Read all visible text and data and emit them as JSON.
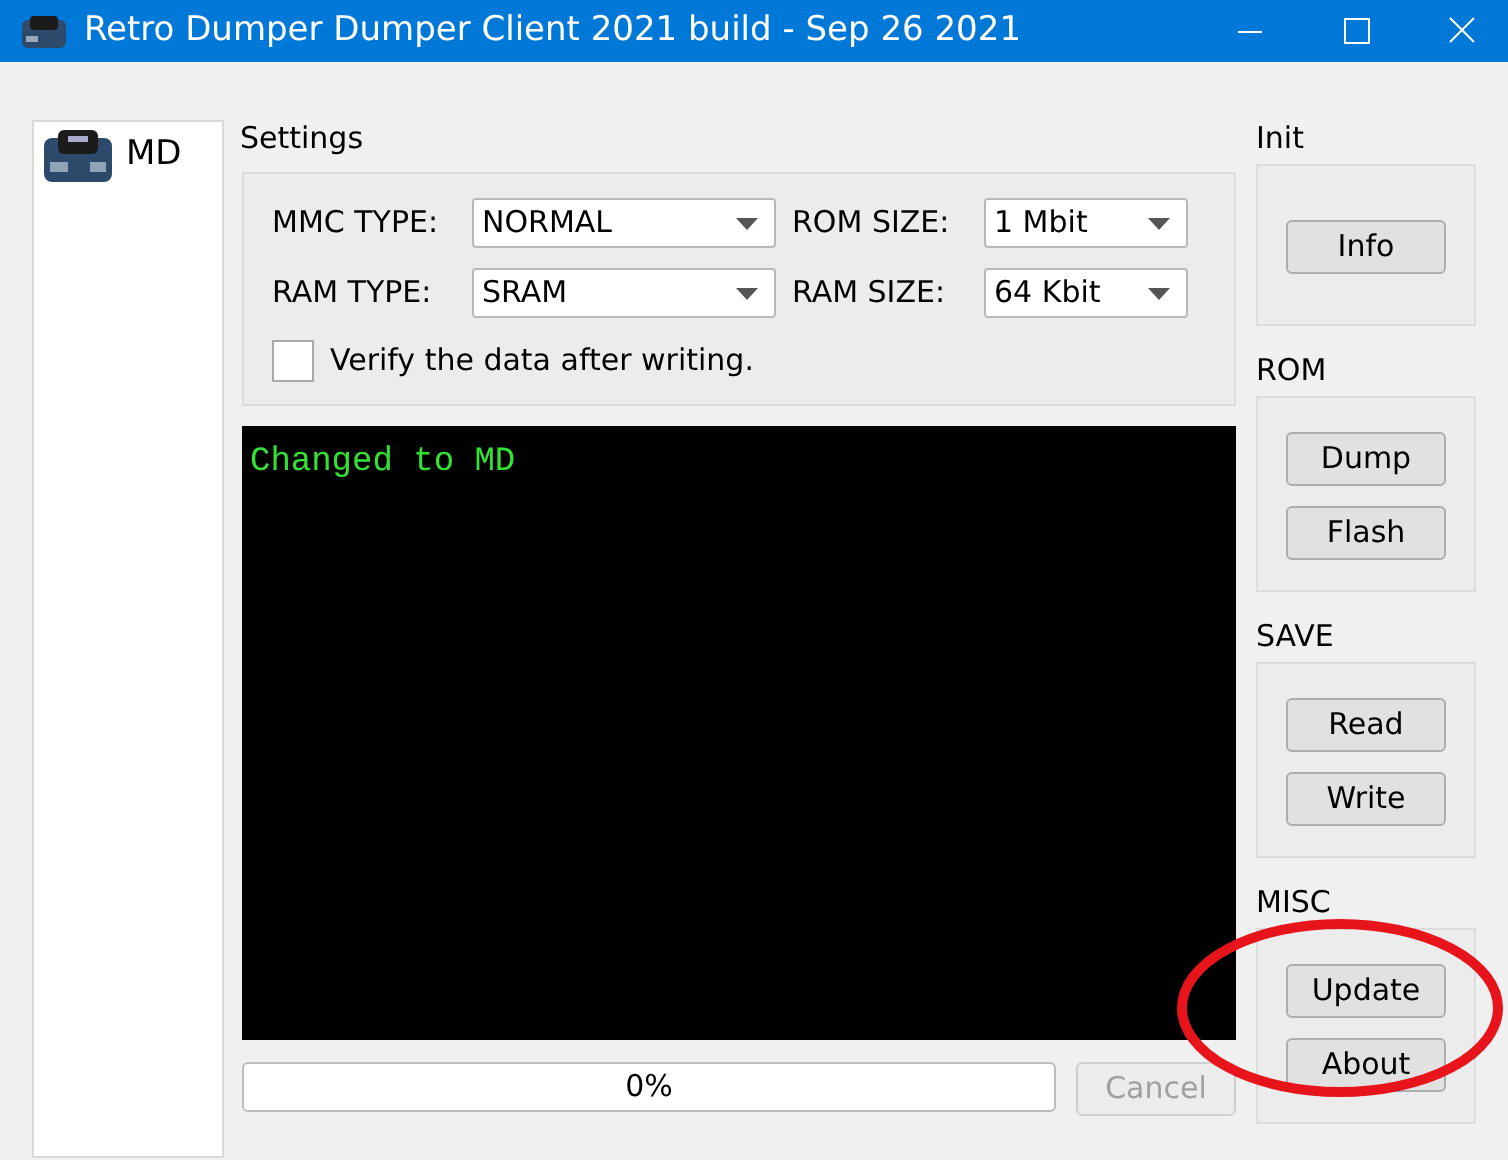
{
  "window": {
    "title": "Retro Dumper Dumper Client 2021 build - Sep 26 2021"
  },
  "sidebar": {
    "items": [
      {
        "label": "MD",
        "selected": false
      }
    ]
  },
  "settings": {
    "title": "Settings",
    "rows": [
      {
        "label": "MMC TYPE:",
        "value": "NORMAL",
        "label_2": "ROM SIZE:",
        "value_2": "1 Mbit"
      },
      {
        "label": "RAM TYPE:",
        "value": "SRAM",
        "label_2": "RAM SIZE:",
        "value_2": "64 Kbit"
      }
    ],
    "verify": {
      "label": "Verify the data after writing.",
      "checked": false
    }
  },
  "console": {
    "lines": [
      "Changed to MD"
    ]
  },
  "progress": {
    "level": 0,
    "reading": "0%"
  },
  "cancel": {
    "label": "Cancel",
    "disabled": true
  },
  "groups": [
    {
      "title": "Init",
      "buttons": [
        "Info"
      ]
    },
    {
      "title": "ROM",
      "buttons": [
        "Dump",
        "Flash"
      ]
    },
    {
      "title": "SAVE",
      "buttons": [
        "Read",
        "Write"
      ]
    },
    {
      "title": "MISC",
      "buttons": [
        "Update",
        "About"
      ]
    }
  ],
  "annotation": {
    "kind": "ellipse",
    "color": "#e8141c"
  }
}
